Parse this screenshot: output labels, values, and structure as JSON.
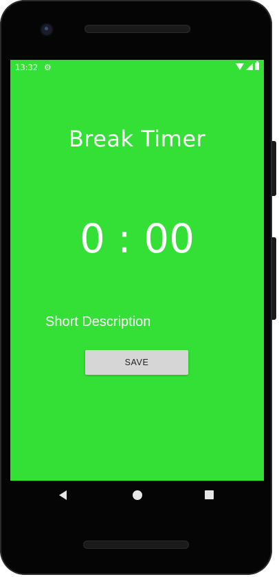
{
  "status_bar": {
    "time": "13:32",
    "icons": [
      "gear-icon",
      "wifi-icon",
      "signal-icon",
      "battery-icon"
    ]
  },
  "screen": {
    "background_color": "#34e035",
    "title": "Break Timer",
    "timer": "0 : 00",
    "description": "Short Description",
    "save_label": "SAVE"
  },
  "nav_bar": {
    "icons": [
      "back-icon",
      "home-icon",
      "recents-icon"
    ]
  }
}
